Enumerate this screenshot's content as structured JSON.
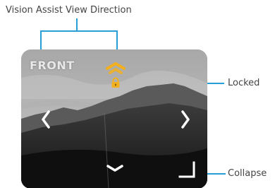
{
  "callouts": {
    "view_direction": "Vision Assist View Direction",
    "locked": "Locked",
    "collapse": "Collapse"
  },
  "view": {
    "direction_label": "FRONT",
    "lock_state": "locked"
  },
  "colors": {
    "callout_line": "#2a9fd6",
    "lock_accent": "#f2b01e",
    "arrow_up_accent": "#f2b01e",
    "arrow_default": "#ffffff"
  },
  "icons": {
    "up": "chevron-up-icon",
    "down": "chevron-down-icon",
    "left": "chevron-left-icon",
    "right": "chevron-right-icon",
    "lock": "lock-icon",
    "collapse": "collapse-corner-icon"
  }
}
